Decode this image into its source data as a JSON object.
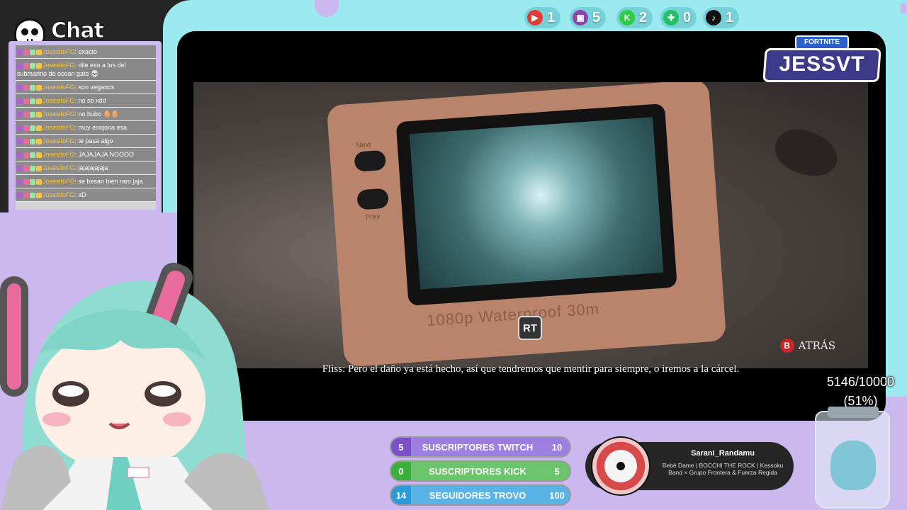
{
  "social": [
    {
      "icon": "youtube-icon",
      "count": "1",
      "color": "#e53935"
    },
    {
      "icon": "twitch-icon",
      "count": "5",
      "color": "#8e44ad"
    },
    {
      "icon": "kick-icon",
      "count": "2",
      "color": "#2ecc40"
    },
    {
      "icon": "trovo-icon",
      "count": "0",
      "color": "#21c065"
    },
    {
      "icon": "tiktok-icon",
      "count": "1",
      "color": "#111111"
    }
  ],
  "chat": {
    "title": "Chat",
    "messages": [
      {
        "user": "JosesitoFG",
        "text": ": exacto"
      },
      {
        "user": "JosesitoFG",
        "text": ": dile eso a los del submarino de ocean gate 💀"
      },
      {
        "user": "JosesitoFG",
        "text": ": son veganos"
      },
      {
        "user": "JosesitoFG",
        "text": ": no se xdd"
      },
      {
        "user": "JosesitoFG",
        "text": ": no hubo 🥚🥚"
      },
      {
        "user": "JosesitoFG",
        "text": ": muy enojona esa"
      },
      {
        "user": "JosesitoFG",
        "text": ": te pasa algo"
      },
      {
        "user": "JosesitoFG",
        "text": ": JAJAJAJA NOOOO"
      },
      {
        "user": "JosesitoFG",
        "text": ": jajajajajaja"
      },
      {
        "user": "JosesitoFG",
        "text": ": se besan bien raro jaja"
      },
      {
        "user": "JosesitoFG",
        "text": ": xD"
      }
    ]
  },
  "game": {
    "device_next": "Next",
    "device_prev": "Prev",
    "device_text": "1080p  Waterproof 30m",
    "rt_label": "RT",
    "back_button": "B",
    "back_label": "ATRÁS",
    "subtitle": "Fliss: Pero el daño ya está hecho, así que tendremos que mentir para siempre, o iremos a la cárcel."
  },
  "logo": {
    "top": "FORTNITE",
    "name": "JESSVT"
  },
  "goal": {
    "count": "5146/10000",
    "percent": "(51%)"
  },
  "goals": [
    {
      "current": "5",
      "label": "SUSCRIPTORES TWITCH",
      "target": "10",
      "color": "#7b4fc9",
      "fill": "#9c7fe0"
    },
    {
      "current": "0",
      "label": "SUSCRIPTORES KICK",
      "target": "5",
      "color": "#3cae3c",
      "fill": "#6cc46c"
    },
    {
      "current": "14",
      "label": "SEGUIDORES TROVO",
      "target": "100",
      "color": "#2a9bd8",
      "fill": "#5ab3e6"
    }
  ],
  "now_playing": {
    "user": "Sarani_Randamu",
    "song": "Bebé Dame | BOCCHI THE ROCK | Kessoku Band × Grupo Frontera & Fuerza Regida"
  }
}
